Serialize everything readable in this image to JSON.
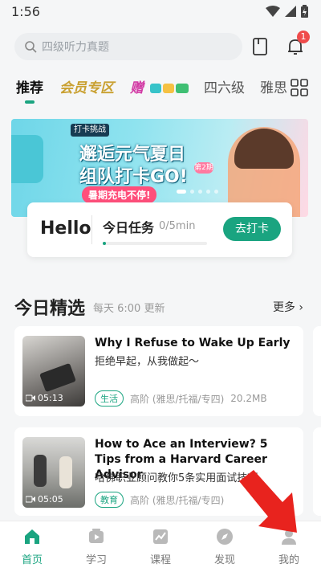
{
  "status": {
    "time": "1:56"
  },
  "search": {
    "placeholder": "四级听力真题"
  },
  "notifications": {
    "count": "1"
  },
  "tabs": [
    "推荐",
    "会员专区",
    "赠",
    "四六级",
    "雅思"
  ],
  "banner": {
    "tag": "打卡挑战",
    "line1": "邂逅元气夏日",
    "line2": "组队打卡GO!",
    "line3": "暑期充电不停!",
    "phase": "第2期"
  },
  "hello": {
    "greeting": "Hello",
    "task_label": "今日任务",
    "progress": "0/5min",
    "progress_fraction": 0.03,
    "button": "去打卡"
  },
  "section": {
    "title": "今日精选",
    "subtitle": "每天 6:00 更新",
    "more": "更多"
  },
  "cards": [
    {
      "title": "Why I Refuse to Wake Up Early",
      "cn": "拒绝早起，从我做起～",
      "duration": "05:13",
      "tag": "生活",
      "level": "高阶 (雅思/托福/专四)",
      "size": "20.2MB"
    },
    {
      "title": "How to Ace an Interview? 5 Tips from a Harvard Career Advisor",
      "cn": "哈佛职业顾问教你5条实用面试技巧",
      "duration": "05:05",
      "tag": "教育",
      "level": "高阶 (雅思/托福/专四)",
      "size": ""
    }
  ],
  "nav": [
    "首页",
    "学习",
    "课程",
    "发现",
    "我的"
  ],
  "colors": {
    "accent": "#1aa480",
    "badge": "#ef4b4b",
    "arrow": "#e8231e"
  }
}
